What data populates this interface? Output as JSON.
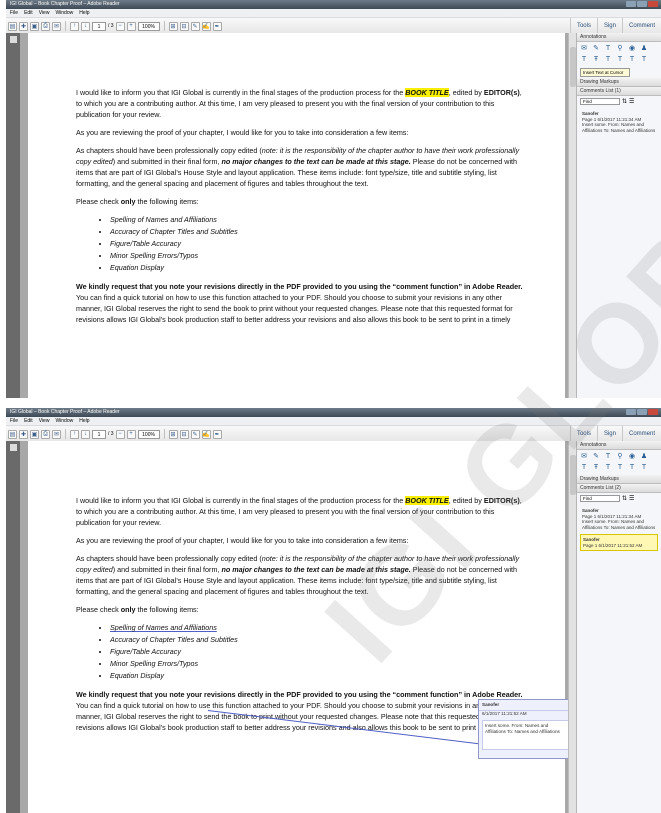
{
  "app": {
    "title": "IGI Global – Book Chapter Proof – Adobe Reader",
    "menus": [
      "File",
      "Edit",
      "View",
      "Window",
      "Help"
    ],
    "page_field": "1",
    "page_total": "/ 3",
    "zoom": "100%",
    "right_tabs": [
      "Tools",
      "Sign",
      "Comment"
    ]
  },
  "document": {
    "p1_pre": "I would like to inform you that IGI Global is currently in the final stages of the production process for the ",
    "p1_highlight": "BOOK TITLE",
    "p1_mid": ", edited by ",
    "p1_editor": "EDITOR(s)",
    "p1_post": ", to which you are a contributing author.  At this time, I am very pleased to present you with the final version of your contribution to this publication for your review.",
    "p2": "As you are reviewing the proof of your chapter, I would like for you to take into consideration a few items:",
    "p3_pre": "As chapters should have been professionally copy edited (",
    "p3_note": "note: it is the responsibility of the chapter author to have their work professionally copy edited",
    "p3_mid": ") and submitted in their final form, ",
    "p3_bold": "no major changes to the text can be made at this stage.",
    "p3_post": "  Please do not be concerned with items that are part of IGI Global’s House Style and layout application. These items include: font type/size, title and subtitle styling, list formatting, and the general spacing and placement of figures and tables throughout the text.",
    "p4_pre": "Please check ",
    "p4_bold": "only",
    "p4_post": " the following items:",
    "items": [
      "Spelling of Names and Affiliations",
      "Accuracy of Chapter Titles and Subtitles",
      "Figure/Table Accuracy",
      "Minor Spelling Errors/Typos",
      "Equation Display"
    ],
    "p5_bold": "We kindly request that you note your revisions directly in the PDF provided to you using the “comment function” in Adobe Reader.",
    "p5_post": " You can find a quick tutorial on how to use this function attached to your PDF. Should you choose to submit your revisions in any other manner, IGI Global reserves the right to send the book to print without your requested changes. Please note that this requested format for revisions allows IGI Global’s book production staff to better address your revisions and also allows this book to be sent to print in a timely"
  },
  "panel": {
    "annotations": "Annotations",
    "drawing_markups": "Drawing Markups",
    "comments_list": "Comments List (1)",
    "comments_list_2": "Comments List (2)",
    "find_placeholder": "Find",
    "tooltip": "Insert Text at Cursor",
    "comment1_author": "Sanofer",
    "comment1_meta": "Page 1 6/1/2017 11:21:34 AM",
    "comment1_text": "Insert some. From: Names and Affiliations To: Names and Affiliations",
    "comment2_author": "Sanofer",
    "comment2_meta": "Page 1 6/1/2017 11:21:52 AM"
  },
  "popup": {
    "author": "Sanofer",
    "date": "6/1/2017 11:21:52 AM",
    "text": "Insert some. From: Names and Affiliations To: Names and Affiliations"
  },
  "watermark": "IGI GLOBAL PROOF"
}
